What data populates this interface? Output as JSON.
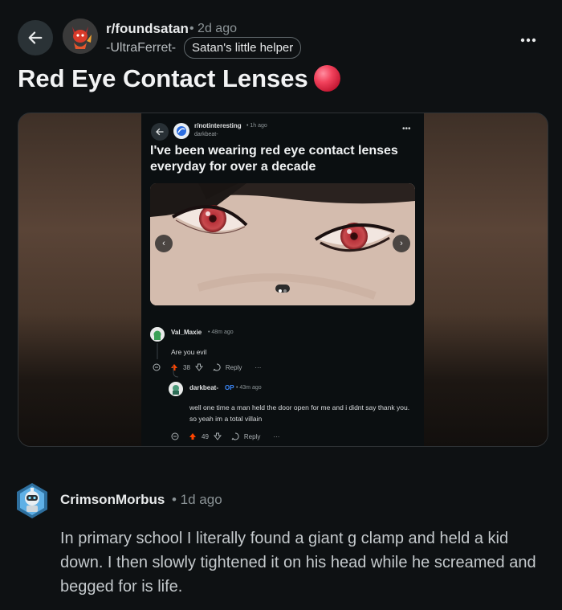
{
  "header": {
    "subreddit": "r/foundsatan",
    "time_ago": "• 2d ago",
    "author": "-UltraFerret-",
    "flair": "Satan's little helper"
  },
  "post": {
    "title": "Red Eye Contact Lenses"
  },
  "embedded": {
    "subreddit": "r/notinteresting",
    "time_ago": "• 1h ago",
    "user": "darkbeat-",
    "title": "I've been wearing red eye contact lenses everyday for over a decade",
    "comments": [
      {
        "author": "Val_Maxie",
        "time": "• 48m ago",
        "text": "Are you evil",
        "votes": "38",
        "reply_label": "Reply"
      },
      {
        "author": "darkbeat-",
        "op_tag": "OP",
        "time": "• 43m ago",
        "text": "well one time a man held the door open for me and i didnt say thank you. so yeah im a total villain",
        "votes": "49",
        "reply_label": "Reply"
      }
    ]
  },
  "comment": {
    "author": "CrimsonMorbus",
    "time_ago": "• 1d ago",
    "body": "In primary school I literally found a giant g clamp and held a kid down. I then slowly tightened it on his head while he screamed and begged for is life."
  },
  "colors": {
    "background": "#0e1113",
    "upvote": "#ff4500",
    "op_blue": "#3d8bff"
  }
}
